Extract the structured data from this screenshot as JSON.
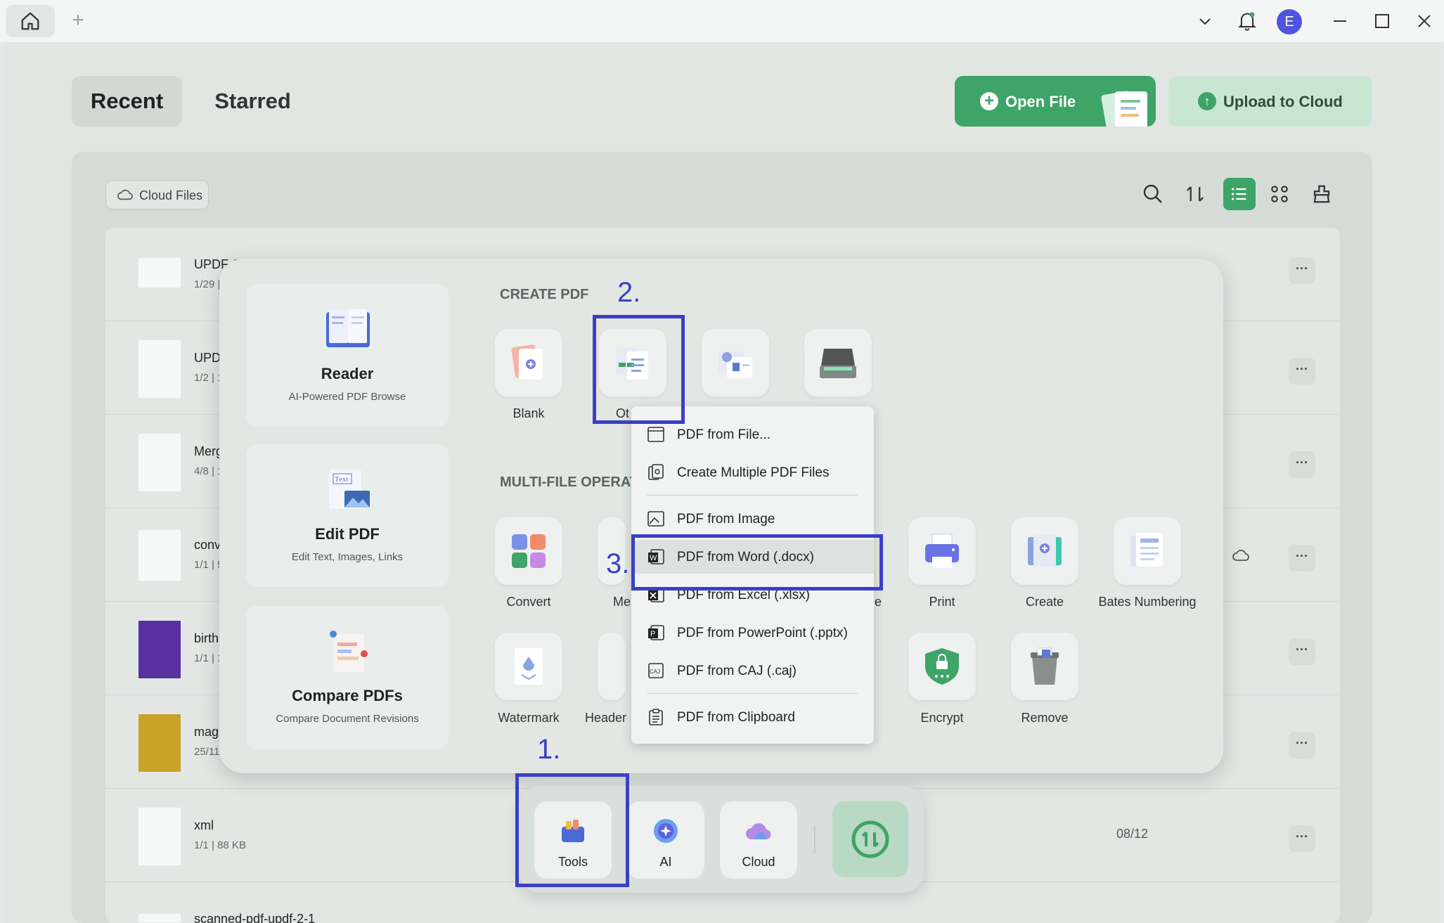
{
  "header": {
    "avatar_letter": "E"
  },
  "tabs": {
    "recent": "Recent",
    "starred": "Starred"
  },
  "actions": {
    "open_file": "Open File",
    "upload_cloud": "Upload to Cloud"
  },
  "toolbar": {
    "cloud_files": "Cloud Files"
  },
  "files": [
    {
      "name": "UPDF-2",
      "meta": "1/29 |"
    },
    {
      "name": "UPD",
      "meta": "1/2 | 1"
    },
    {
      "name": "Merg",
      "meta": "4/8 | 1"
    },
    {
      "name": "conv",
      "meta": "1/1 | 5"
    },
    {
      "name": "birth",
      "meta": "1/1 | 1"
    },
    {
      "name": "mag",
      "meta": "25/113"
    },
    {
      "name": "xml",
      "meta": "1/1 | 88 KB",
      "date": "08/12"
    },
    {
      "name": "scanned-pdf-updf-2-1",
      "meta": ""
    }
  ],
  "cards": {
    "reader": {
      "title": "Reader",
      "subtitle": "AI-Powered PDF Browse"
    },
    "edit": {
      "title": "Edit PDF",
      "subtitle": "Edit Text, Images, Links",
      "badge": "Text"
    },
    "compare": {
      "title": "Compare PDFs",
      "subtitle": "Compare Document Revisions"
    }
  },
  "create_pdf": {
    "title": "CREATE PDF",
    "tiles": {
      "blank": "Blank",
      "other": "Ot"
    }
  },
  "multi_file": {
    "title": "MULTI-FILE OPERAT",
    "row1": {
      "convert": "Convert",
      "merge": "Me",
      "e_partial": "e",
      "print": "Print",
      "create": "Create",
      "bates": "Bates Numbering"
    },
    "row2": {
      "watermark": "Watermark",
      "header": "Header",
      "encrypt": "Encrypt",
      "remove": "Remove"
    }
  },
  "menu": {
    "items": [
      "PDF from File...",
      "Create Multiple PDF Files",
      "PDF from Image",
      "PDF from Word (.docx)",
      "PDF from Excel (.xlsx)",
      "PDF from PowerPoint (.pptx)",
      "PDF from CAJ (.caj)",
      "PDF from Clipboard"
    ],
    "selected_index": 3
  },
  "dock": {
    "tools": "Tools",
    "ai": "AI",
    "cloud": "Cloud"
  },
  "annotations": {
    "n1": "1.",
    "n2": "2.",
    "n3": "3."
  },
  "colors": {
    "accent": "#3ea467",
    "highlight": "#3b3fc6",
    "avatar": "#4f53e0"
  }
}
